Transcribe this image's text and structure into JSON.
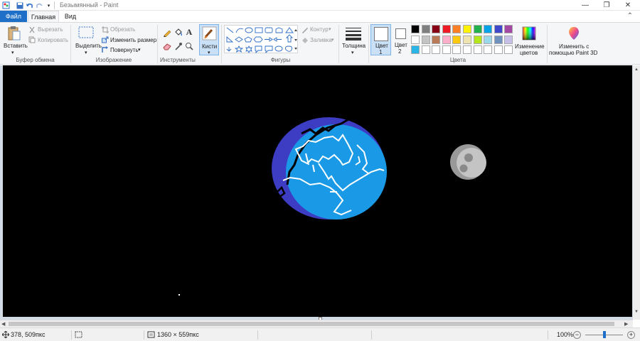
{
  "window": {
    "title": "Безымянный - Paint",
    "controls": {
      "minimize": "—",
      "maximize": "❐",
      "close": "✕"
    }
  },
  "tabs": {
    "file": "Файл",
    "home": "Главная",
    "view": "Вид"
  },
  "ribbon": {
    "clipboard": {
      "paste": "Вставить",
      "cut": "Вырезать",
      "copy": "Копировать",
      "group": "Буфер обмена"
    },
    "image": {
      "select": "Выделить",
      "crop": "Обрезать",
      "resize": "Изменить размер",
      "rotate": "Повернуть",
      "group": "Изображение"
    },
    "tools": {
      "group": "Инструменты"
    },
    "brushes": {
      "label": "Кисти"
    },
    "shapes": {
      "outline": "Контур",
      "fill": "Заливка",
      "group": "Фигуры"
    },
    "size": {
      "label": "Толщина"
    },
    "color1": {
      "line1": "Цвет",
      "line2": "1"
    },
    "color2": {
      "line1": "Цвет",
      "line2": "2"
    },
    "colors": {
      "group": "Цвета",
      "edit_line1": "Изменение",
      "edit_line2": "цветов",
      "palette_row1": [
        "#000000",
        "#7f7f7f",
        "#880015",
        "#ed1c24",
        "#ff7f27",
        "#fff200",
        "#22b14c",
        "#00a2e8",
        "#3f48cc",
        "#a349a4"
      ],
      "palette_row2": [
        "#ffffff",
        "#c3c3c3",
        "#b97a57",
        "#ffaec9",
        "#ffc90e",
        "#efe4b0",
        "#b5e61d",
        "#99d9ea",
        "#7092be",
        "#c8bfe7"
      ],
      "palette_row3": [
        "#29b6e6",
        "#ffffff",
        "#ffffff",
        "#ffffff",
        "#ffffff",
        "#ffffff",
        "#ffffff",
        "#ffffff",
        "#ffffff",
        "#ffffff"
      ],
      "current_color1": "#ffffff",
      "current_color2": "#ffffff"
    },
    "paint3d": {
      "line1": "Изменить с",
      "line2": "помощью Paint 3D"
    }
  },
  "status": {
    "cursor_pos": "378, 509пкс",
    "canvas_size": "1360 × 559пкс",
    "zoom": "100%"
  }
}
